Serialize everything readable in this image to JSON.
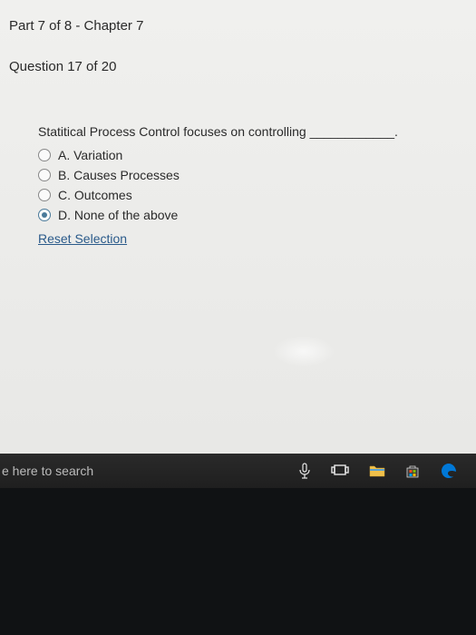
{
  "header": {
    "part_label": "Part 7 of 8 - Chapter 7",
    "question_label": "Question 17 of 20"
  },
  "question": {
    "text": "Statitical Process Control focuses on controlling ____________.",
    "options": [
      {
        "label": "A. Variation",
        "selected": false
      },
      {
        "label": "B. Causes Processes",
        "selected": false
      },
      {
        "label": "C. Outcomes",
        "selected": false
      },
      {
        "label": "D. None of the above",
        "selected": true
      }
    ],
    "reset_label": "Reset Selection"
  },
  "taskbar": {
    "search_placeholder": "e here to search"
  }
}
